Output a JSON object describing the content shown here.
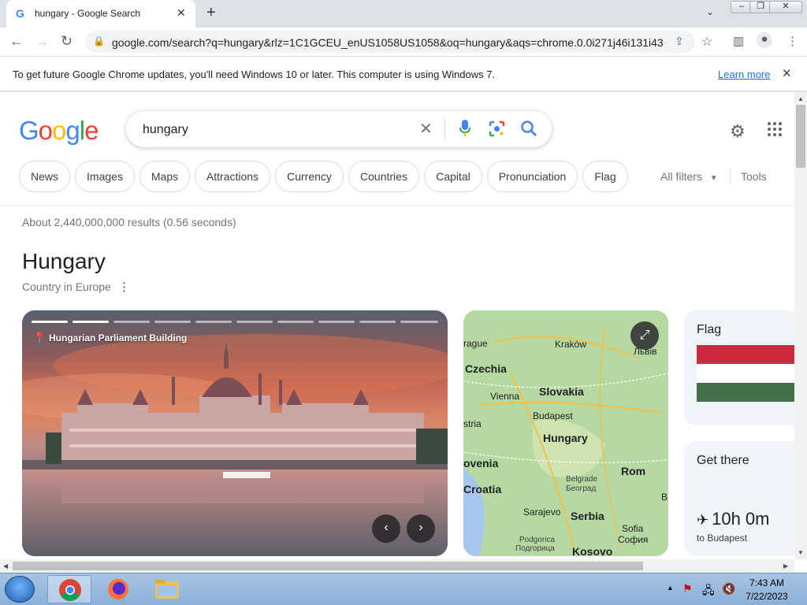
{
  "browser": {
    "tab_title": "hungary - Google Search",
    "favicon_letter": "G",
    "url": "google.com/search?q=hungary&rlz=1C1GCEU_enUS1058US1058&oq=hungary&aqs=chrome.0.0i271j46i131i43...",
    "infobar_message": "To get future Google Chrome updates, you'll need Windows 10 or later. This computer is using Windows 7.",
    "infobar_link": "Learn more"
  },
  "google": {
    "logo": [
      "G",
      "o",
      "o",
      "g",
      "l",
      "e"
    ],
    "logo_colors": [
      "#4285f4",
      "#ea4335",
      "#fbbc05",
      "#4285f4",
      "#34a853",
      "#ea4335"
    ],
    "query": "hungary",
    "chips": [
      "News",
      "Images",
      "Maps",
      "Attractions",
      "Currency",
      "Countries",
      "Capital",
      "Pronunciation",
      "Flag"
    ],
    "all_filters": "All filters",
    "tools": "Tools",
    "stats": "About 2,440,000,000 results (0.56 seconds)"
  },
  "knowledge_panel": {
    "title": "Hungary",
    "subtitle": "Country in Europe",
    "photo_caption": "Hungarian Parliament Building",
    "map_labels": {
      "prague": "rague",
      "krakow": "Kraków",
      "lviv": "Львів",
      "czechia": "Czechia",
      "vienna": "Vienna",
      "slovakia": "Slovakia",
      "austria": "stria",
      "budapest": "Budapest",
      "hungary": "Hungary",
      "slovenia": "ovenia",
      "croatia": "Croatia",
      "belgrade": "Belgrade",
      "beograd": "Београд",
      "romania": "Rom",
      "sarajevo": "Sarajevo",
      "serbia": "Serbia",
      "sofia": "Sofia",
      "sofia_cyr": "София",
      "podgorica": "Podgorica",
      "podgorica_cyr": "Подгорица",
      "kosovo": "Kosovo",
      "b": "B"
    },
    "flag_title": "Flag",
    "flag_colors": [
      "#cd2a3e",
      "#ffffff",
      "#436f4d"
    ],
    "get_there_title": "Get there",
    "travel_time": "10h 0m",
    "travel_dest": "to Budapest"
  },
  "taskbar": {
    "time": "7:43 AM",
    "date": "7/22/2023"
  }
}
